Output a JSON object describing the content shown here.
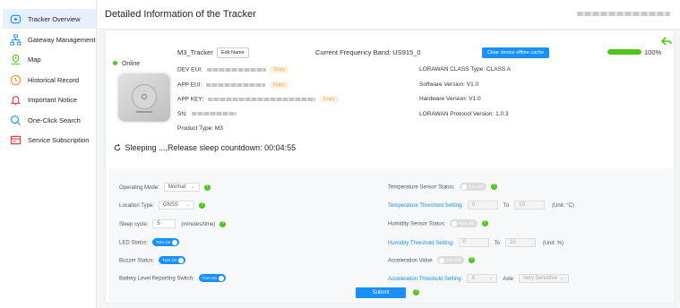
{
  "sidebar": {
    "items": [
      {
        "label": "Tracker Overview",
        "icon": "tracker-icon",
        "active": true
      },
      {
        "label": "Gateway Management",
        "icon": "network-icon"
      },
      {
        "label": "Map",
        "icon": "map-icon"
      },
      {
        "label": "Historical Record",
        "icon": "history-icon"
      },
      {
        "label": "Important Notice",
        "icon": "bell-icon"
      },
      {
        "label": "One-Click Search",
        "icon": "search-icon"
      },
      {
        "label": "Service Subscription",
        "icon": "subscription-icon"
      }
    ]
  },
  "header": {
    "title": "Detailed Information of the Tracker"
  },
  "tracker": {
    "status": "Online",
    "name": "M3_Tracker",
    "edit_label": "Edit Name",
    "frequency_band": "Current Frequency Band: US915_0",
    "clear_cache_label": "Clear device offline cache",
    "battery": "100%",
    "battery_level": 1.0,
    "dev_eui_label": "DEV EUI:",
    "app_eui_label": "APP EUI:",
    "app_key_label": "APP KEY:",
    "sn_label": "SN:",
    "copy_label": "Copy",
    "product_type": "Product Type: M3",
    "lorawan_class": "LORAWAN CLASS Type: CLASS A",
    "software_version": "Software Version: V1.0",
    "hardware_version": "Hardware Version: V1.0",
    "lorawan_protocol": "LORAWAN Protocol Version: 1.0.3",
    "sleep_status": "Sleeping ...,Release sleep countdown: 00:04:55"
  },
  "settings": {
    "operating_mode": {
      "label": "Operating Mode:",
      "value": "Normal"
    },
    "location_type": {
      "label": "Location Type:",
      "value": "GNSS"
    },
    "sleep_cycle": {
      "label": "Sleep cycle:",
      "value": "5",
      "unit": "(minutes/time)"
    },
    "led_status": {
      "label": "LED Status:",
      "toggle": "Turn On"
    },
    "buzzer_status": {
      "label": "Buzzer Status:",
      "toggle": "Turn On"
    },
    "battery_switch": {
      "label": "Battery Level Reporting Switch:",
      "toggle": "Turn On"
    },
    "temp_sensor": {
      "label": "Temperature Sensor Status:",
      "toggle": "Turn Off"
    },
    "temp_threshold": {
      "label": "Temperature Threshold Setting:",
      "min": "0",
      "to": "To",
      "max": "10",
      "unit": "(Unit: °C)"
    },
    "humidity_sensor": {
      "label": "Humidity Sensor Status:",
      "toggle": "Turn Off"
    },
    "humidity_threshold": {
      "label": "Humidity Threshold Setting:",
      "min": "0",
      "to": "To",
      "max": "10",
      "unit": "(Unit: %)"
    },
    "acceleration": {
      "label": "Acceleration Value",
      "toggle": "Turn Off"
    },
    "accel_threshold": {
      "label": "Acceleration Threshold Setting:",
      "axis_value": "X",
      "axle_label": "Axle",
      "sensitivity": "Very Sensitive"
    },
    "submit_label": "Submit"
  },
  "colors": {
    "accent": "#1890ff",
    "online": "#52c41a",
    "copy": "#f0a050"
  }
}
